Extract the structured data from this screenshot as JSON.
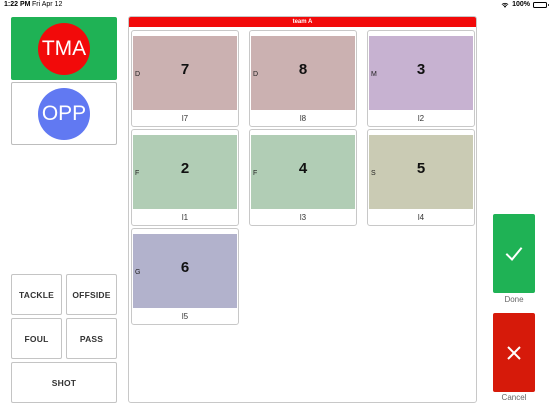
{
  "status_bar": {
    "time": "1:22 PM",
    "date": "Fri Apr 12",
    "battery": "100%"
  },
  "teams": [
    {
      "label": "TMA",
      "color": "#f20a0a",
      "selected": true
    },
    {
      "label": "OPP",
      "color": "#6179f2",
      "selected": false
    }
  ],
  "actions": {
    "tackle": "TACKLE",
    "offside": "OFFSIDE",
    "foul": "FOUL",
    "pass": "PASS",
    "shot": "SHOT"
  },
  "panel": {
    "header": "team A",
    "players": [
      {
        "position": "D",
        "number": "7",
        "label": "l7",
        "color": "#cbb1b1"
      },
      {
        "position": "D",
        "number": "8",
        "label": "l8",
        "color": "#cbb1b1"
      },
      {
        "position": "M",
        "number": "3",
        "label": "l2",
        "color": "#c7b2d1"
      },
      {
        "position": "F",
        "number": "2",
        "label": "l1",
        "color": "#b1cdb5"
      },
      {
        "position": "F",
        "number": "4",
        "label": "l3",
        "color": "#b1cdb5"
      },
      {
        "position": "S",
        "number": "5",
        "label": "l4",
        "color": "#cacbb4"
      },
      {
        "position": "G",
        "number": "6",
        "label": "l5",
        "color": "#b2b2cc"
      }
    ]
  },
  "done": {
    "label": "Done",
    "color": "#1fb255"
  },
  "cancel": {
    "label": "Cancel",
    "color": "#d61a0a"
  }
}
